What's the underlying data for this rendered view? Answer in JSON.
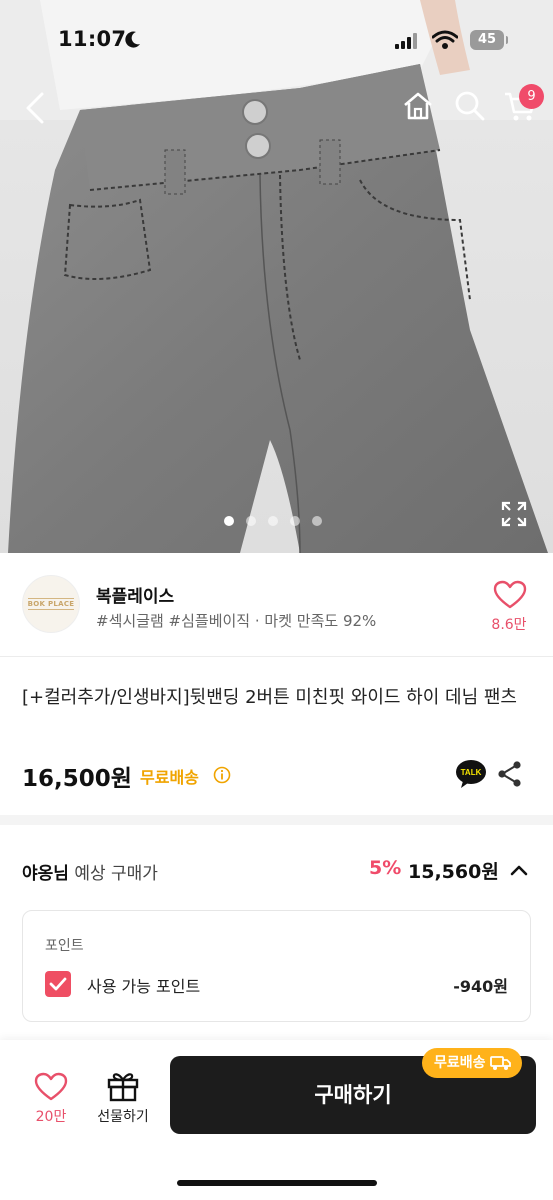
{
  "status_bar": {
    "time": "11:07",
    "battery": "45"
  },
  "nav": {
    "cart_count": "9"
  },
  "carousel": {
    "dot_count": 5,
    "active_index": 0
  },
  "seller": {
    "logo_text": "BOK PLACE",
    "name": "복플레이스",
    "tags": "#섹시글램 #심플베이직 · 마켓 만족도 92%",
    "like_count": "8.6만"
  },
  "product": {
    "title": "[+컬러추가/인생바지]뒷밴딩 2버튼 미친핏 와이드 하이 데님 팬츠",
    "price": "16,500원",
    "free_shipping": "무료배송",
    "talk_label": "TALK"
  },
  "expected_price": {
    "user": "야옹님",
    "label": "예상 구매가",
    "discount_rate": "5%",
    "final_price": "15,560원"
  },
  "points": {
    "title": "포인트",
    "usable_label": "사용 가능 포인트",
    "usable_value": "-940원"
  },
  "bottom_bar": {
    "like_count": "20만",
    "gift_label": "선물하기",
    "buy_label": "구매하기",
    "free_shipping_badge": "무료배송"
  },
  "colors": {
    "accent_pink": "#f04b6a",
    "shipping_orange": "#f0a400",
    "buy_button": "#1c1c1c"
  }
}
